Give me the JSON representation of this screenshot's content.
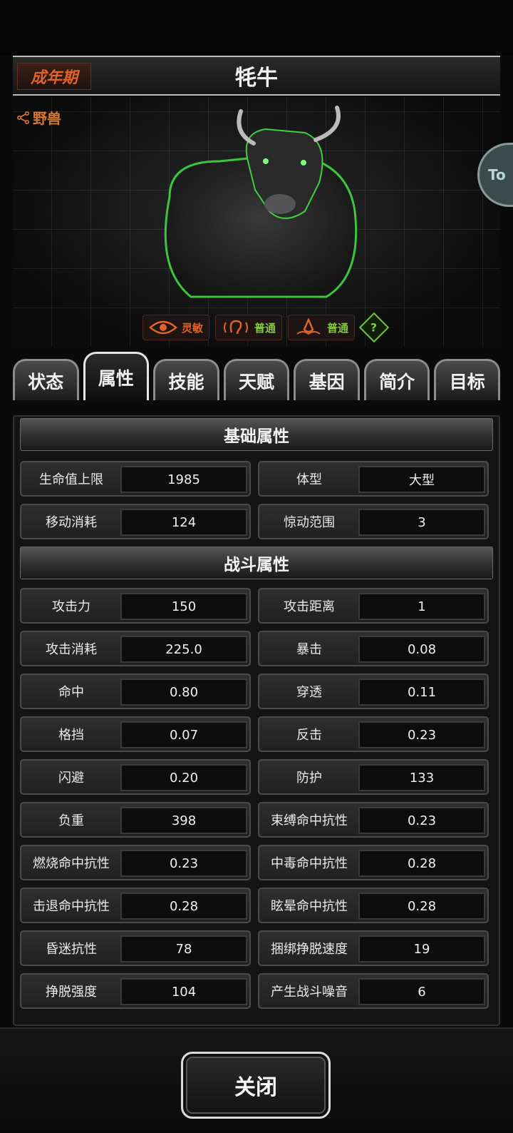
{
  "header": {
    "stage": "成年期",
    "name": "牦牛",
    "category": "野兽"
  },
  "side_tab_text": "To",
  "senses": [
    {
      "icon": "eye-icon",
      "label": "灵敏",
      "color": "#e0632a"
    },
    {
      "icon": "ear-icon",
      "label": "普通",
      "color": "#7fc940"
    },
    {
      "icon": "nose-icon",
      "label": "普通",
      "color": "#7fc940"
    }
  ],
  "help_label": "?",
  "tabs": [
    {
      "label": "状态",
      "active": false
    },
    {
      "label": "属性",
      "active": true
    },
    {
      "label": "技能",
      "active": false
    },
    {
      "label": "天赋",
      "active": false
    },
    {
      "label": "基因",
      "active": false
    },
    {
      "label": "简介",
      "active": false
    },
    {
      "label": "目标",
      "active": false
    }
  ],
  "basic": {
    "title": "基础属性",
    "stats": [
      {
        "label": "生命值上限",
        "value": "1985"
      },
      {
        "label": "体型",
        "value": "大型"
      },
      {
        "label": "移动消耗",
        "value": "124"
      },
      {
        "label": "惊动范围",
        "value": "3"
      }
    ]
  },
  "combat": {
    "title": "战斗属性",
    "stats": [
      {
        "label": "攻击力",
        "value": "150"
      },
      {
        "label": "攻击距离",
        "value": "1"
      },
      {
        "label": "攻击消耗",
        "value": "225.0"
      },
      {
        "label": "暴击",
        "value": "0.08"
      },
      {
        "label": "命中",
        "value": "0.80"
      },
      {
        "label": "穿透",
        "value": "0.11"
      },
      {
        "label": "格挡",
        "value": "0.07"
      },
      {
        "label": "反击",
        "value": "0.23"
      },
      {
        "label": "闪避",
        "value": "0.20"
      },
      {
        "label": "防护",
        "value": "133"
      },
      {
        "label": "负重",
        "value": "398"
      },
      {
        "label": "束缚命中抗性",
        "value": "0.23"
      },
      {
        "label": "燃烧命中抗性",
        "value": "0.23"
      },
      {
        "label": "中毒命中抗性",
        "value": "0.28"
      },
      {
        "label": "击退命中抗性",
        "value": "0.28"
      },
      {
        "label": "眩晕命中抗性",
        "value": "0.28"
      },
      {
        "label": "昏迷抗性",
        "value": "78"
      },
      {
        "label": "捆绑挣脱速度",
        "value": "19"
      },
      {
        "label": "挣脱强度",
        "value": "104"
      },
      {
        "label": "产生战斗噪音",
        "value": "6"
      }
    ]
  },
  "close_label": "关闭"
}
